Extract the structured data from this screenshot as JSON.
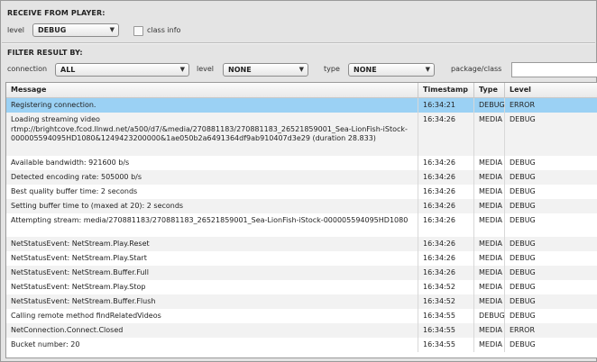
{
  "receive": {
    "title": "RECEIVE FROM PLAYER:",
    "level_label": "level",
    "level_value": "DEBUG",
    "class_info_label": "class info"
  },
  "filter": {
    "title": "FILTER RESULT BY:",
    "connection_label": "connection",
    "connection_value": "ALL",
    "level_label": "level",
    "level_value": "NONE",
    "type_label": "type",
    "type_value": "NONE",
    "package_label": "package/class",
    "package_value": ""
  },
  "grid": {
    "columns": [
      "Message",
      "Timestamp",
      "Type",
      "Level"
    ],
    "rows": [
      {
        "message": "Registering connection.",
        "timestamp": "16:34:21",
        "type": "DEBUG",
        "level": "ERROR",
        "selected": true
      },
      {
        "message": "Loading streaming video rtmp://brightcove.fcod.llnwd.net/a500/d7/&media/270881183/270881183_26521859001_Sea-LionFish-iStock-000005594095HD1080&1249423200000&1ae050b2a6491364df9ab910407d3e29 (duration 28.833)",
        "timestamp": "16:34:26",
        "type": "MEDIA",
        "level": "DEBUG"
      },
      {
        "message": "Available bandwidth: 921600 b/s",
        "timestamp": "16:34:26",
        "type": "MEDIA",
        "level": "DEBUG"
      },
      {
        "message": "Detected encoding rate: 505000 b/s",
        "timestamp": "16:34:26",
        "type": "MEDIA",
        "level": "DEBUG"
      },
      {
        "message": "Best quality buffer time: 2 seconds",
        "timestamp": "16:34:26",
        "type": "MEDIA",
        "level": "DEBUG"
      },
      {
        "message": "Setting buffer time to (maxed at 20): 2 seconds",
        "timestamp": "16:34:26",
        "type": "MEDIA",
        "level": "DEBUG"
      },
      {
        "message": "Attempting stream: media/270881183/270881183_26521859001_Sea-LionFish-iStock-000005594095HD1080",
        "timestamp": "16:34:26",
        "type": "MEDIA",
        "level": "DEBUG"
      },
      {
        "message": "NetStatusEvent: NetStream.Play.Reset",
        "timestamp": "16:34:26",
        "type": "MEDIA",
        "level": "DEBUG"
      },
      {
        "message": "NetStatusEvent: NetStream.Play.Start",
        "timestamp": "16:34:26",
        "type": "MEDIA",
        "level": "DEBUG"
      },
      {
        "message": "NetStatusEvent: NetStream.Buffer.Full",
        "timestamp": "16:34:26",
        "type": "MEDIA",
        "level": "DEBUG"
      },
      {
        "message": "NetStatusEvent: NetStream.Play.Stop",
        "timestamp": "16:34:52",
        "type": "MEDIA",
        "level": "DEBUG"
      },
      {
        "message": "NetStatusEvent: NetStream.Buffer.Flush",
        "timestamp": "16:34:52",
        "type": "MEDIA",
        "level": "DEBUG"
      },
      {
        "message": "Calling remote method findRelatedVideos",
        "timestamp": "16:34:55",
        "type": "DEBUG",
        "level": "DEBUG"
      },
      {
        "message": "NetConnection.Connect.Closed",
        "timestamp": "16:34:55",
        "type": "MEDIA",
        "level": "ERROR"
      },
      {
        "message": "Bucket number: 20",
        "timestamp": "16:34:55",
        "type": "MEDIA",
        "level": "DEBUG"
      }
    ]
  },
  "colors": {
    "selected_row": "#9bd1f4",
    "panel_bg": "#e4e4e4"
  }
}
